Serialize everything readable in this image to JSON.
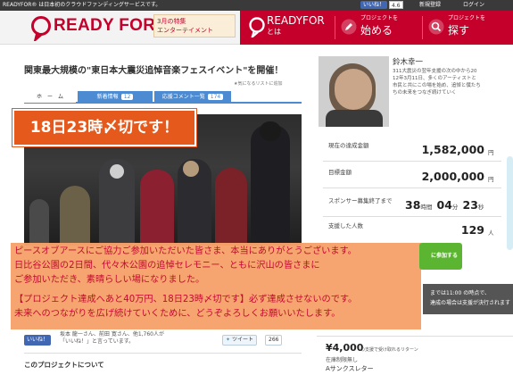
{
  "topbar": {
    "tagline": "READYFOR® は日本初のクラウドファンディングサービスです。",
    "like_label": "いいね！",
    "like_count": "4.6",
    "register_label": "新規登録",
    "login_label": "ログイン"
  },
  "header": {
    "logo_text": "READY FOR?",
    "promo_line1": "3月の特集",
    "promo_line2": "エンターテイメント",
    "nav_about_line1": "READYFOR",
    "nav_about_line2": "とは",
    "nav_start_line1": "プロジェクトを",
    "nav_start_line2": "始める",
    "nav_find_line1": "プロジェクトを",
    "nav_find_line2": "探す"
  },
  "project": {
    "title": "関東最大規模の\"東日本大震災追悼音楽フェスイベント\"を開催！",
    "tabs": {
      "home": "ホ　ー　ム",
      "news_label": "新着情報",
      "news_count": "12",
      "comments_label": "応援コメント一覧",
      "comments_count": "174"
    },
    "fav_label": "★気になるリストに追加",
    "deadline_banner": "18日23時〆切です！",
    "message_lines": [
      "ピースオブアースにご協力ご参加いただいた皆さま、本当にありがとうございます。",
      "日比谷公園の2日間、代々木公園の追悼セレモニー、ともに沢山の皆さまに",
      "ご参加いただき、素晴らしい場になりました。",
      "【プロジェクト達成へあと40万円、18日23時〆切です】必ず達成させないのです。",
      "未来へのつながりを広げ続けていくために、どうぞよろしくお願いいたします。"
    ],
    "share": {
      "like_label": "いいね！",
      "like_text": "坂本 龍一さん、前田 寛さん、他1,760人が",
      "like_text2": "「いいね！」と言っています。",
      "tweet_label": "ツイート",
      "tweet_count": "266"
    },
    "about_heading": "このプロジェクトについて"
  },
  "owner": {
    "name": "鈴木幸一",
    "desc_lines": [
      "311大震災の翌年支援の次の中から20",
      "12年3月11日、多くのアーティストと",
      "市民と共にこの場を始め、追悼と僕たち",
      "ちの未来をつなぎ続けていく"
    ]
  },
  "stats": {
    "current_label": "現在の達成金額",
    "current_value": "1,582,000",
    "goal_label": "目標金額",
    "goal_value": "2,000,000",
    "unit_yen": "円",
    "remaining_label": "スポンサー募集終了まで",
    "remaining_days": "38",
    "remaining_hours": "04",
    "remaining_minutes": "23",
    "unit_day": "時間",
    "unit_hour": "分",
    "unit_min": "秒",
    "supporters_label": "支援した人数",
    "supporters_value": "129",
    "unit_person": "人"
  },
  "support_button_label": "に参加する",
  "dark_notice": {
    "line1": "までは11:00 の時点で、",
    "line2": "達成の場合は支援が決行されます"
  },
  "reward": {
    "price": "¥4,000",
    "note": "の支援で受け取れるリターン",
    "count": "在庫制限無し",
    "name": "Aサンクスレター"
  }
}
